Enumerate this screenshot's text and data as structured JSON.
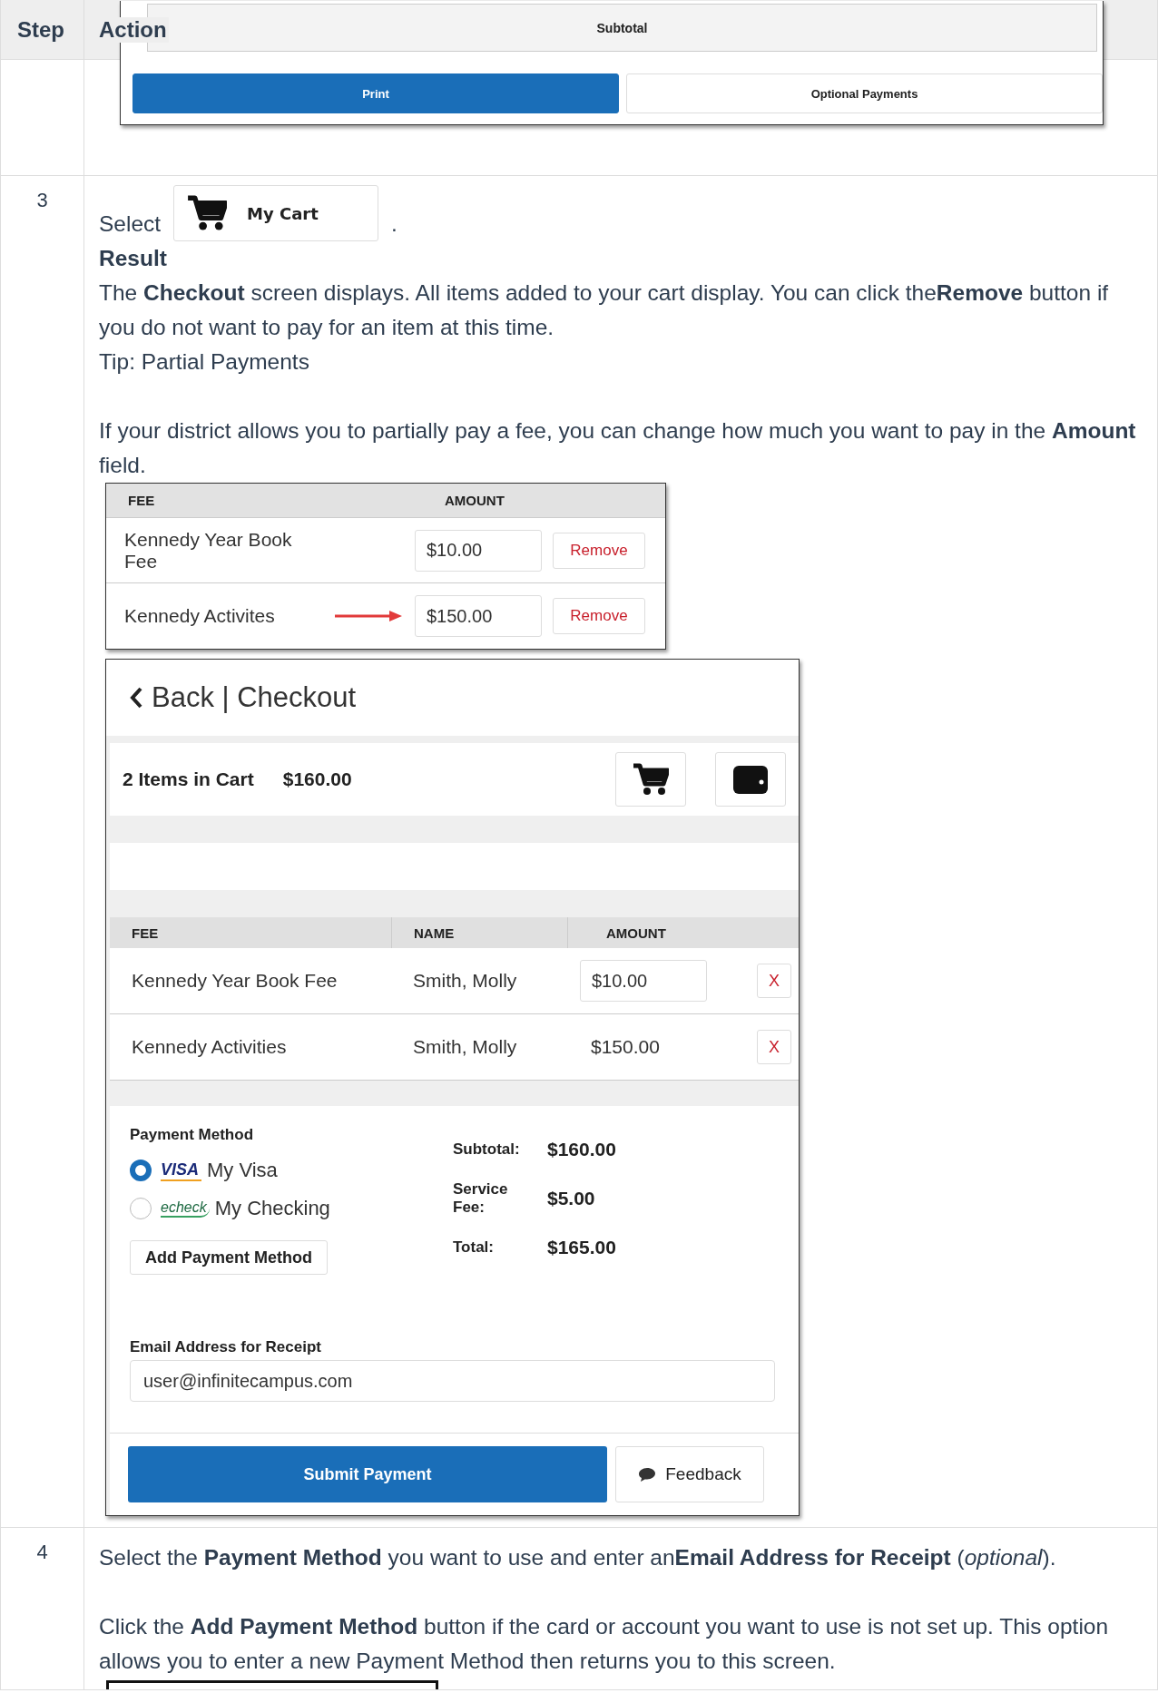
{
  "table": {
    "columns": [
      "Step",
      "Action"
    ],
    "rows": [
      {
        "kind": "snippet",
        "step": "",
        "subtotal_label": "Subtotal",
        "buttons": [
          {
            "label": "Print",
            "primary": true
          },
          {
            "label": "Optional Payments",
            "primary": false
          }
        ]
      },
      {
        "kind": "checkout",
        "step": "3",
        "select_prefix": "Select",
        "cart_button": "My Cart",
        "select_suffix": ".",
        "result_heading": "Result",
        "blocks": [
          [
            "The **Checkout** screen displays. All items added to your cart display. You can click the**Remove** button if you do not want to pay for an item at this time.",
            "Tip: Partial Payments"
          ],
          [
            "If your district allows you to partially pay a fee, you can change how much you want to pay in the **Amount** field."
          ]
        ],
        "fee_table": {
          "columns": [
            "FEE",
            "AMOUNT"
          ],
          "rows": [
            {
              "fee": "Kennedy Year Book Fee",
              "amount": "$10.00",
              "action": "Remove",
              "pointed": false
            },
            {
              "fee": "Kennedy Activites",
              "amount": "$150.00",
              "action": "Remove",
              "pointed": true
            }
          ]
        },
        "checkout": {
          "back": "Back | Checkout",
          "cart_count": "2 Items in Cart",
          "cart_total": "$160.00",
          "columns": [
            "FEE",
            "NAME",
            "AMOUNT"
          ],
          "rows": [
            {
              "fee": "Kennedy Year Book Fee",
              "name": "Smith, Molly",
              "amount": "$10.00",
              "editable": true,
              "remove": "X"
            },
            {
              "fee": "Kennedy Activities",
              "name": "Smith, Molly",
              "amount": "$150.00",
              "editable": false,
              "remove": "X"
            }
          ],
          "payment_method_label": "Payment Method",
          "methods": [
            {
              "kind": "visa",
              "brand": "VISA",
              "label": "My Visa",
              "selected": true
            },
            {
              "kind": "echeck",
              "brand": "echeck",
              "label": "My Checking",
              "selected": false
            }
          ],
          "add_button": "Add Payment Method",
          "totals": [
            {
              "label": "Subtotal:",
              "value": "$160.00"
            },
            {
              "label": "Service Fee:",
              "value": "$5.00"
            },
            {
              "label": "Total:",
              "value": "$165.00"
            }
          ],
          "email_label": "Email Address for Receipt",
          "email": "user@infinitecampus.com",
          "submit": "Submit Payment",
          "feedback": "Feedback"
        }
      },
      {
        "kind": "text",
        "step": "4",
        "blocks": [
          [
            "Select the **Payment Method** you want to use and enter an**Email Address for Receipt** (*optional*)."
          ],
          [
            "Click the **Add Payment Method** button if the card or account you want to use is not set up. This option allows you to enter a new Payment Method then returns you to this screen."
          ]
        ]
      }
    ]
  }
}
